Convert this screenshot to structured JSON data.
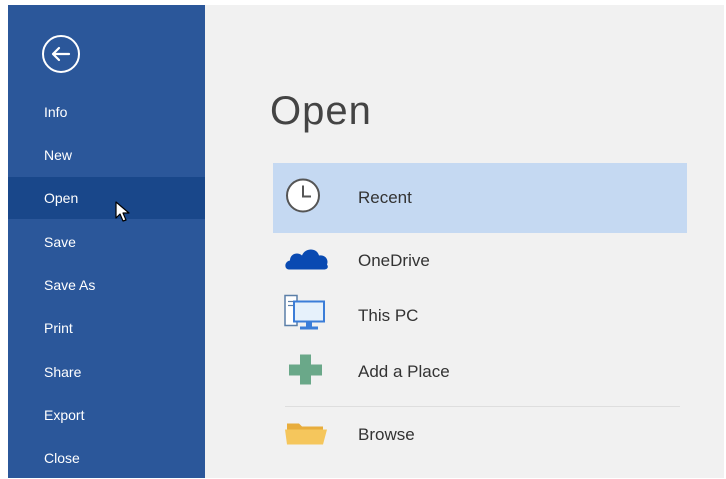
{
  "backstage": {
    "back_button_icon": "back-arrow-icon",
    "nav_items": [
      {
        "label": "Info"
      },
      {
        "label": "New"
      },
      {
        "label": "Open"
      },
      {
        "label": "Save"
      },
      {
        "label": "Save As"
      },
      {
        "label": "Print"
      },
      {
        "label": "Share"
      },
      {
        "label": "Export"
      },
      {
        "label": "Close"
      }
    ],
    "active_item": "Open"
  },
  "main": {
    "title": "Open",
    "places": [
      {
        "label": "Recent",
        "icon": "clock-icon"
      },
      {
        "label": "OneDrive",
        "icon": "onedrive-cloud-icon"
      },
      {
        "label": "This PC",
        "icon": "computer-icon"
      },
      {
        "label": "Add a Place",
        "icon": "plus-icon"
      },
      {
        "label": "Browse",
        "icon": "folder-icon"
      }
    ]
  },
  "colors": {
    "sidebar_bg": "#2b579a",
    "sidebar_active": "#19478a",
    "selected_bg": "#c5d9f2",
    "onedrive_blue": "#094ab2",
    "plus_green": "#6aa889",
    "folder_yellow": "#f5c65c"
  }
}
